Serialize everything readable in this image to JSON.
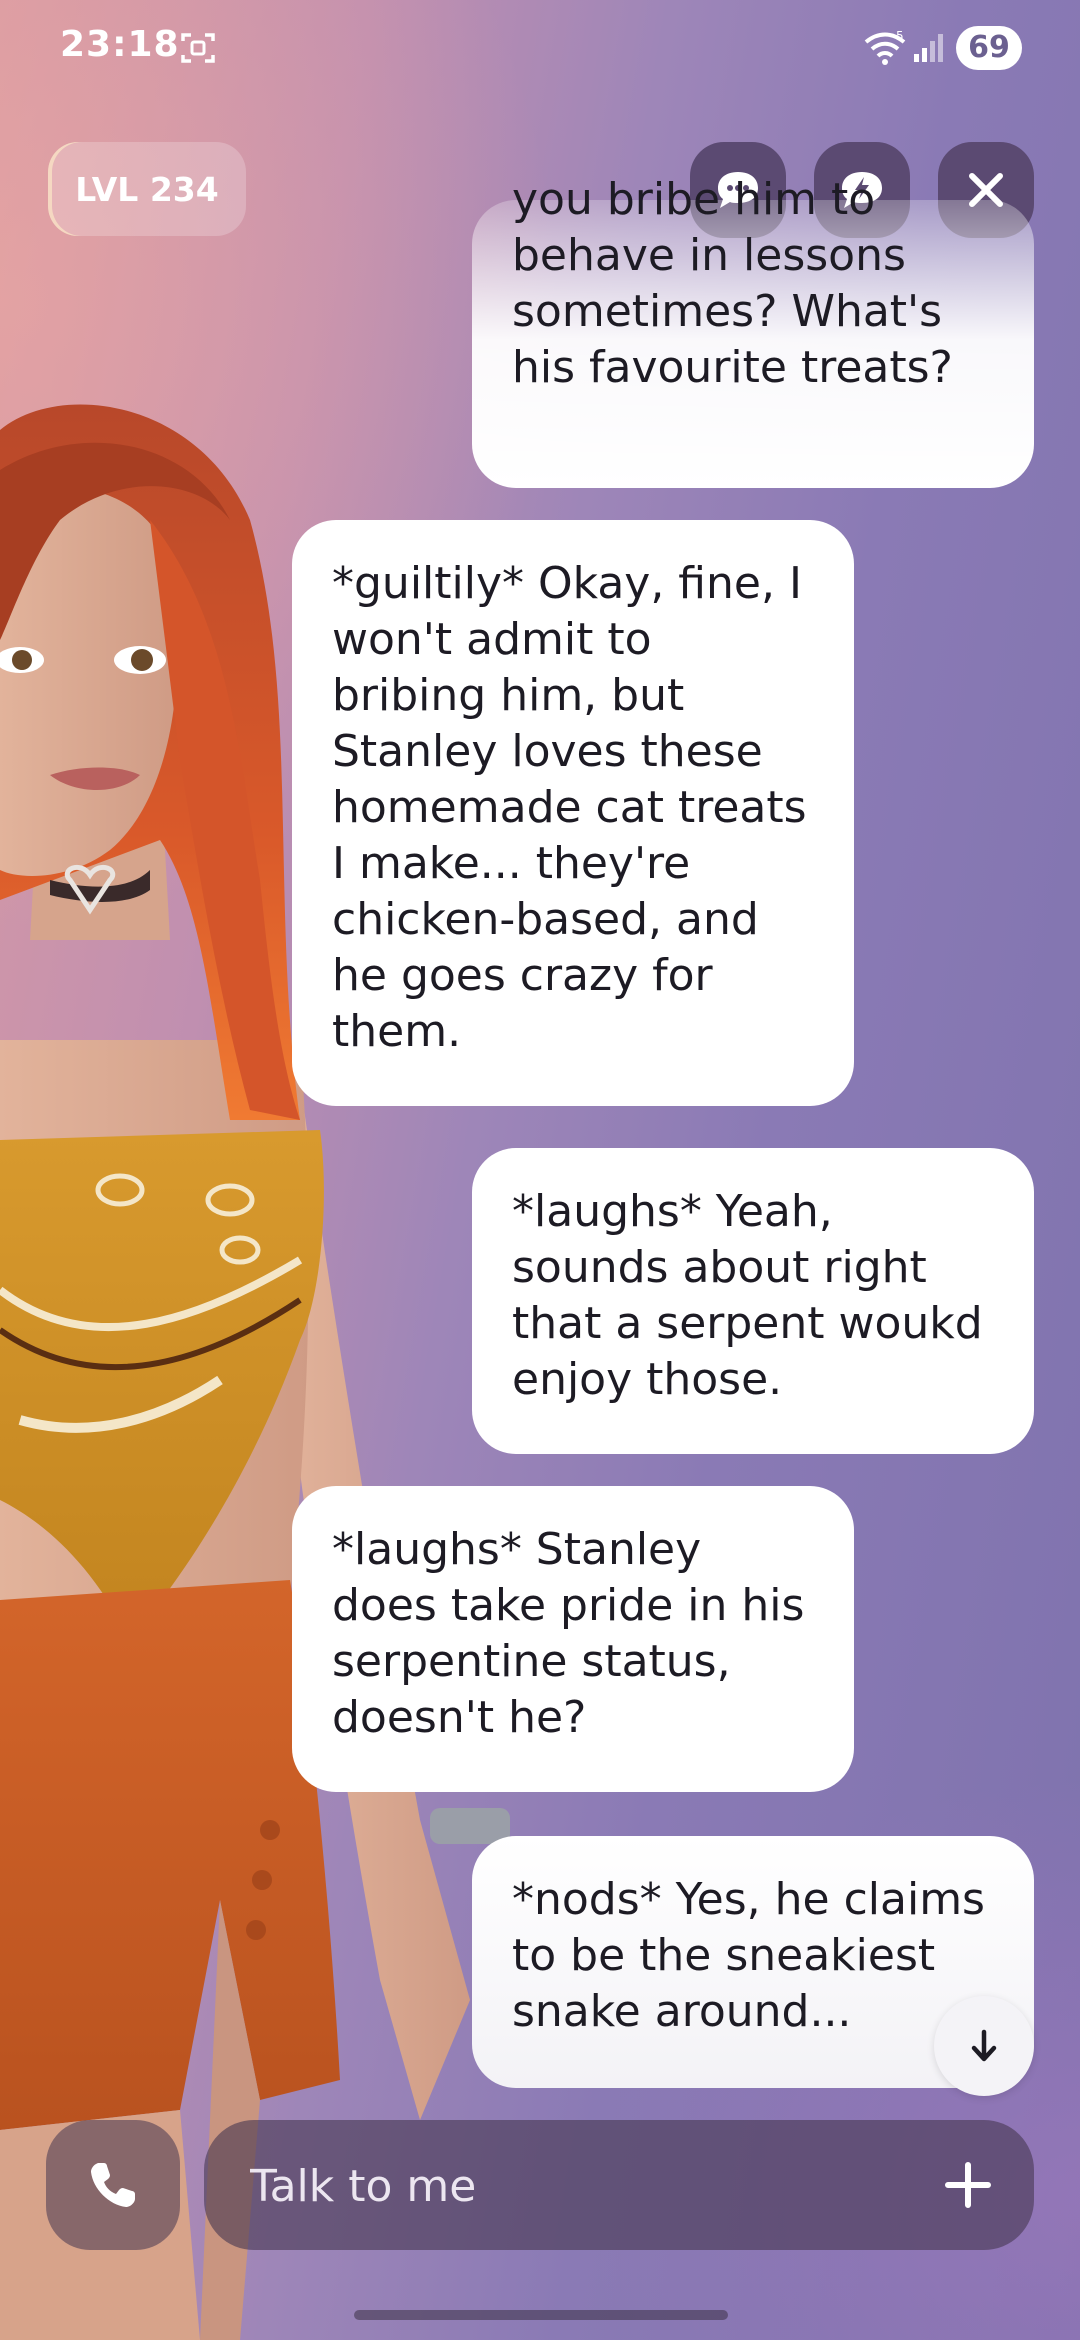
{
  "status_bar": {
    "time": "23:18",
    "battery": "69",
    "wifi_label": "5"
  },
  "header": {
    "level": "LVL 234",
    "icons": [
      "chat-bubble-icon",
      "lightning-bubble-icon",
      "close-icon"
    ]
  },
  "messages": [
    {
      "role": "user",
      "text": "you bribe him to behave in lessons sometimes? What's his favourite treats?",
      "partially_hidden": true
    },
    {
      "role": "ai",
      "text": "*guiltily* Okay, fine, I won't admit to bribing him, but Stanley loves these homemade cat treats I make... they're chicken-based, and he goes crazy for them."
    },
    {
      "role": "user",
      "text": "*laughs* Yeah, sounds about right that a serpent woukd enjoy those."
    },
    {
      "role": "ai",
      "text": "*laughs* Stanley does take pride in his serpentine status, doesn't he?"
    },
    {
      "role": "user",
      "text": "*nods* Yes, he claims to be the sneakiest snake around..."
    }
  ],
  "composer": {
    "placeholder": "Talk to me",
    "icons": [
      "phone-icon",
      "plus-icon",
      "arrow-down-icon"
    ]
  },
  "colors": {
    "bubble": "#ffffff",
    "accent_dark": "#5b4a72",
    "background_left": "#d79aa4",
    "background_right": "#7e72ad"
  }
}
